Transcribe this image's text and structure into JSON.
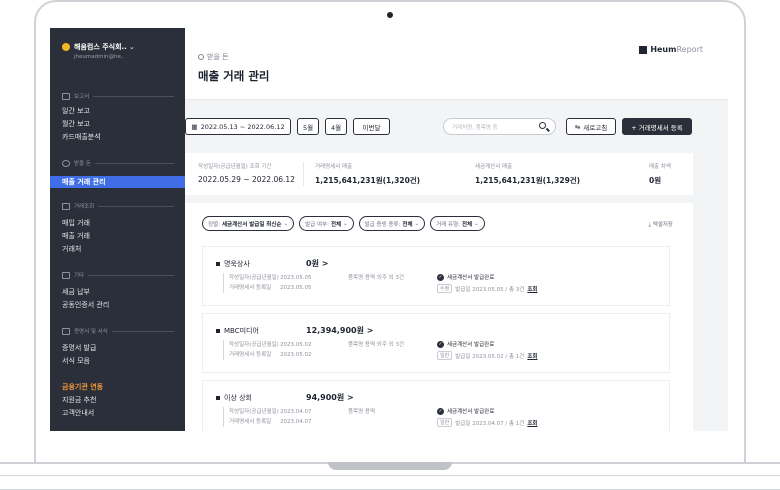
{
  "sidebar": {
    "company_name": "해움컴스 주식회..",
    "company_email": "jheumadmin@he..",
    "sections": {
      "report": "보고서",
      "receivable": "받을 돈",
      "transactions": "거래조회",
      "tax": "기타",
      "cert": "증명서 및 서식"
    },
    "items": {
      "daily": "일간 보고",
      "monthly": "월간 보고",
      "card": "카드매출분석",
      "sales": "매출 거래 관리",
      "purchase": "매입 거래",
      "sales_tx": "매출 거래",
      "client": "거래처",
      "tax_pay": "세금 납부",
      "cert_mgmt": "공동인증서 관리",
      "cert_issue": "증명서 발급",
      "forms": "서식 모음",
      "finance": "금융기관 연동",
      "grant": "지원금 추천",
      "guide": "고객안내서"
    }
  },
  "header": {
    "breadcrumb": "받을 돈",
    "title": "매출 거래 관리",
    "brand_bold": "Heum",
    "brand_light": "Report"
  },
  "toolbar": {
    "date_range": "2022.05.13 ~ 2022.06.12",
    "month5": "5월",
    "month4": "4월",
    "prev_month": "이번달",
    "search_placeholder": "거래처명, 품목명 등",
    "refresh": "새로고침",
    "register": "+ 거래명세서 등록"
  },
  "summary": {
    "period_label": "작성일자(공급년월일) 조회 기간",
    "period_value": "2022.05.29 ~ 2022.06.12",
    "statement_label": "거래명세서 매출",
    "statement_value": "1,215,641,231원(1,320건)",
    "tax_label": "세금계산서 매출",
    "tax_value": "1,215,641,231원(1,329건)",
    "diff_label": "매출 차액",
    "diff_value": "0원"
  },
  "filters": [
    {
      "label": "정렬:",
      "value": "세금계산서 발급일 최신순"
    },
    {
      "label": "발급 여부:",
      "value": "전체"
    },
    {
      "label": "발급 증빙 종류:",
      "value": "전체"
    },
    {
      "label": "거래 유형:",
      "value": "전체"
    }
  ],
  "excel": "엑셀저장",
  "records": [
    {
      "name": "명욱상사",
      "amount": "0원 >",
      "written_label": "작성일자(공급년월일)",
      "written_date": "2023.05.05",
      "reg_label": "거래명세서 등록일",
      "reg_date": "2023.05.05",
      "items": "품목명  용역 외주 외 3건",
      "status": "세금계산서 발급완료",
      "tag": "수정",
      "issue": "발급일 2023.05.05 / 총 3건",
      "view": "조회"
    },
    {
      "name": "MBC미디어",
      "amount": "12,394,900원 >",
      "written_label": "작성일자(공급년월일)",
      "written_date": "2023.05.02",
      "reg_label": "거래명세서 등록일",
      "reg_date": "2023.05.02",
      "items": "품목명  용역 외주 외 3건",
      "status": "세금계산서 발급완료",
      "tag": "일반",
      "issue": "발급일 2023.05.02 / 총 1건",
      "view": "조회"
    },
    {
      "name": "이상 상회",
      "amount": "94,900원 >",
      "written_label": "작성일자(공급년월일)",
      "written_date": "2023.04.07",
      "reg_label": "거래명세서 등록일",
      "reg_date": "2023.04.07",
      "items": "품목명  용역",
      "status": "세금계산서 발급완료",
      "tag": "일반",
      "issue": "발급일 2023.04.07 / 총 1건",
      "view": "조회"
    }
  ]
}
